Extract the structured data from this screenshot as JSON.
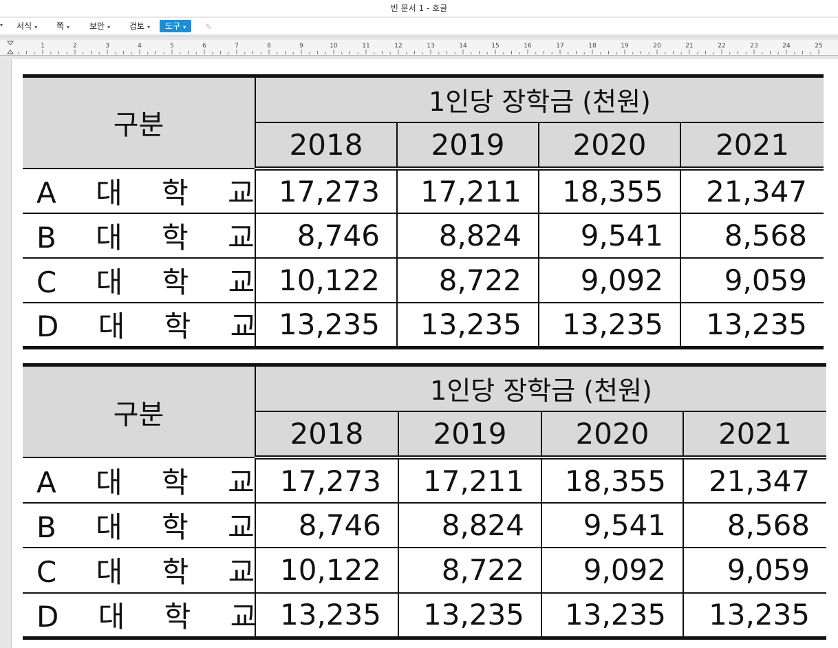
{
  "window": {
    "title": "빈 문서 1 - 호글"
  },
  "menu": {
    "items": [
      {
        "label": "서식",
        "active": false
      },
      {
        "label": "쪽",
        "active": false
      },
      {
        "label": "보안",
        "active": false
      },
      {
        "label": "검토",
        "active": false
      },
      {
        "label": "도구",
        "active": true
      }
    ]
  },
  "ruler": {
    "labels": [
      "1",
      "2",
      "3",
      "4",
      "5",
      "6",
      "7",
      "8",
      "9",
      "10",
      "11",
      "12",
      "13",
      "14",
      "15",
      "16",
      "17",
      "18",
      "19",
      "20",
      "21",
      "22",
      "23",
      "24",
      "25"
    ]
  },
  "tables": [
    {
      "corner": "구분",
      "group_header": "1인당 장학금 (천원)",
      "years": [
        "2018",
        "2019",
        "2020",
        "2021"
      ],
      "rows": [
        {
          "name": "A 대 학 교",
          "values": [
            "17,273",
            "17,211",
            "18,355",
            "21,347"
          ]
        },
        {
          "name": "B 대 학 교",
          "values": [
            "8,746",
            "8,824",
            "9,541",
            "8,568"
          ]
        },
        {
          "name": "C 대 학 교",
          "values": [
            "10,122",
            "8,722",
            "9,092",
            "9,059"
          ]
        },
        {
          "name": "D 대 학 교",
          "values": [
            "13,235",
            "13,235",
            "13,235",
            "13,235"
          ]
        }
      ]
    },
    {
      "corner": "구분",
      "group_header": "1인당 장학금 (천원)",
      "years": [
        "2018",
        "2019",
        "2020",
        "2021"
      ],
      "rows": [
        {
          "name": "A 대 학 교",
          "values": [
            "17,273",
            "17,211",
            "18,355",
            "21,347"
          ]
        },
        {
          "name": "B 대 학 교",
          "values": [
            "8,746",
            "8,824",
            "9,541",
            "8,568"
          ]
        },
        {
          "name": "C 대 학 교",
          "values": [
            "10,122",
            "8,722",
            "9,092",
            "9,059"
          ]
        },
        {
          "name": "D 대 학 교",
          "values": [
            "13,235",
            "13,235",
            "13,235",
            "13,235"
          ]
        }
      ]
    }
  ]
}
